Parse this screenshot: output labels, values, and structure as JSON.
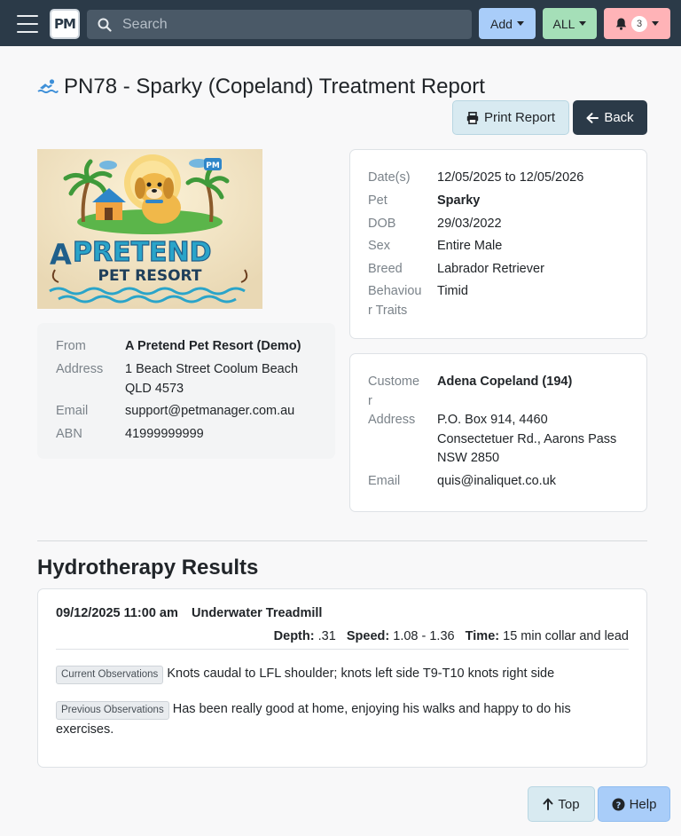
{
  "nav": {
    "logo": "PM",
    "search_placeholder": "Search",
    "add_label": "Add",
    "all_label": "ALL",
    "notification_count": "3"
  },
  "page": {
    "title": "PN78 - Sparky (Copeland) Treatment Report",
    "print_label": "Print Report",
    "back_label": "Back"
  },
  "logo_image": {
    "line1": "A",
    "line2": "PRETEND",
    "line3": "PET RESORT",
    "badge": "PM"
  },
  "from": {
    "from_label": "From",
    "from_value": "A Pretend Pet Resort (Demo)",
    "address_label": "Address",
    "address_line1": "1 Beach Street Coolum Beach",
    "address_line2": "QLD 4573",
    "email_label": "Email",
    "email_value": "support@petmanager.com.au",
    "abn_label": "ABN",
    "abn_value": "41999999999"
  },
  "pet": {
    "dates_label": "Date(s)",
    "dates_value": "12/05/2025 to 12/05/2026",
    "pet_label": "Pet",
    "pet_value": "Sparky",
    "dob_label": "DOB",
    "dob_value": "29/03/2022",
    "sex_label": "Sex",
    "sex_value": "Entire Male",
    "breed_label": "Breed",
    "breed_value": "Labrador Retriever",
    "behaviour_label_1": "Behaviou",
    "behaviour_label_2": "r Traits",
    "behaviour_value": "Timid"
  },
  "customer": {
    "customer_label_1": "Custome",
    "customer_label_2": "r",
    "customer_value": "Adena Copeland (194)",
    "address_label": "Address",
    "address_line1": "P.O. Box 914, 4460",
    "address_line2": "Consectetuer Rd., Aarons Pass",
    "address_line3": "NSW 2850",
    "email_label": "Email",
    "email_value": "quis@inaliquet.co.uk"
  },
  "results": {
    "section_title": "Hydrotherapy Results",
    "datetime": "09/12/2025 11:00 am",
    "treatment": "Underwater Treadmill",
    "depth_label": "Depth:",
    "depth_value": ".31",
    "speed_label": "Speed:",
    "speed_value": "1.08 - 1.36",
    "time_label": "Time:",
    "time_value": "15 min collar and lead",
    "current_tag": "Current Observations",
    "current_text": "Knots caudal to LFL shoulder; knots left side T9-T10 knots right side",
    "previous_tag": "Previous Observations",
    "previous_text_1": "Has been really good at home, enjoying his walks and happy to do his",
    "previous_text_2": "exercises."
  },
  "footer": {
    "top_label": "Top",
    "help_label": "Help"
  }
}
